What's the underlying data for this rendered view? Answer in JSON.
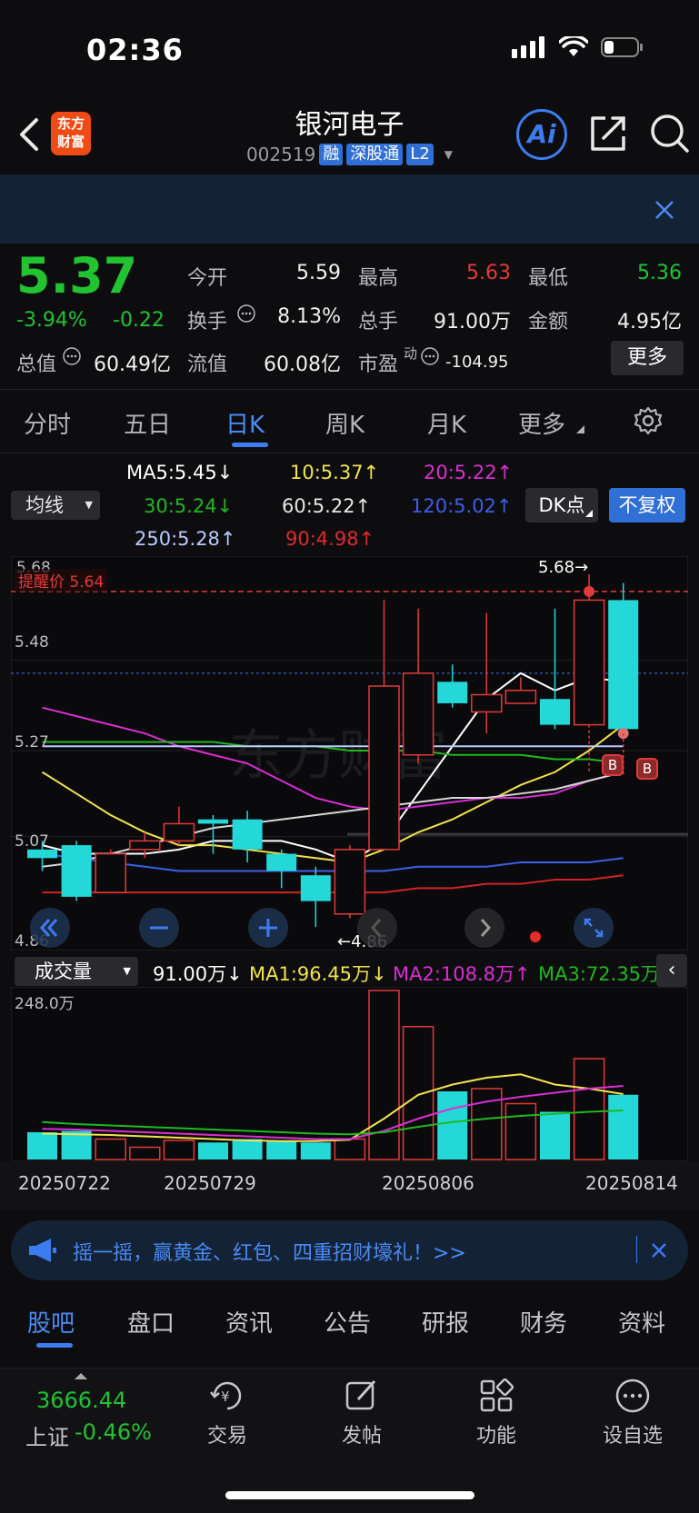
{
  "status": {
    "time": "02:36"
  },
  "header": {
    "logo_line1": "东方",
    "logo_line2": "财富",
    "stock_name": "银河电子",
    "stock_code": "002519",
    "tags": [
      "融",
      "深股通",
      "L2"
    ],
    "ai_label": "Ai"
  },
  "quote": {
    "price": "5.37",
    "change_pct": "-3.94%",
    "change_amt": "-0.22",
    "open_label": "今开",
    "open": "5.59",
    "high_label": "最高",
    "high": "5.63",
    "low_label": "最低",
    "low": "5.36",
    "turnover_label": "换手",
    "turnover": "8.13%",
    "volume_label": "总手",
    "volume": "91.00万",
    "amount_label": "金额",
    "amount": "4.95亿",
    "mktcap_label": "总值",
    "mktcap": "60.49亿",
    "float_label": "流值",
    "float_cap": "60.08亿",
    "pe_label": "市盈",
    "pe_sup": "动",
    "pe": "-104.95",
    "more_label": "更多"
  },
  "chart_tabs": [
    "分时",
    "五日",
    "日K",
    "周K",
    "月K",
    "更多"
  ],
  "ma_panel": {
    "select_label": "均线",
    "ma5": "MA5:5.45↓",
    "ma10": "10:5.37↑",
    "ma20": "20:5.22↑",
    "ma30": "30:5.24↓",
    "ma60": "60:5.22↑",
    "ma120": "120:5.02↑",
    "ma250": "250:5.28↑",
    "ma90": "90:4.98↑",
    "dk_label": "DK点",
    "fq_label": "不复权"
  },
  "kline": {
    "alert_label": "提醒价 5.64",
    "max_label": "5.68→",
    "min_label": "←4.86",
    "y_labels": [
      "5.68",
      "5.48",
      "5.27",
      "5.07",
      "4.86"
    ],
    "watermark": "东方财富",
    "buy_marker": "B"
  },
  "volume": {
    "select_label": "成交量",
    "vol": "91.00万↓",
    "ma1": "MA1:96.45万↓",
    "ma2": "MA2:108.8万↑",
    "ma3": "MA3:72.35万↑",
    "max_label": "248.0万",
    "dates": [
      "20250722",
      "20250729",
      "20250806",
      "20250814"
    ]
  },
  "chart_data": {
    "type": "candlestick",
    "ylim": [
      4.86,
      5.68
    ],
    "candles": [
      {
        "o": 5.04,
        "h": 5.06,
        "l": 4.99,
        "c": 5.02
      },
      {
        "o": 5.05,
        "h": 5.06,
        "l": 4.92,
        "c": 4.93
      },
      {
        "o": 4.94,
        "h": 5.04,
        "l": 4.94,
        "c": 5.03
      },
      {
        "o": 5.04,
        "h": 5.08,
        "l": 5.02,
        "c": 5.06
      },
      {
        "o": 5.06,
        "h": 5.14,
        "l": 5.05,
        "c": 5.1
      },
      {
        "o": 5.11,
        "h": 5.12,
        "l": 5.03,
        "c": 5.1
      },
      {
        "o": 5.11,
        "h": 5.13,
        "l": 5.01,
        "c": 5.04
      },
      {
        "o": 5.03,
        "h": 5.04,
        "l": 4.95,
        "c": 4.99
      },
      {
        "o": 4.98,
        "h": 5.0,
        "l": 4.86,
        "c": 4.92
      },
      {
        "o": 4.89,
        "h": 5.05,
        "l": 4.88,
        "c": 5.04
      },
      {
        "o": 5.04,
        "h": 5.62,
        "l": 5.04,
        "c": 5.42
      },
      {
        "o": 5.26,
        "h": 5.6,
        "l": 5.24,
        "c": 5.45
      },
      {
        "o": 5.43,
        "h": 5.47,
        "l": 5.37,
        "c": 5.38
      },
      {
        "o": 5.36,
        "h": 5.59,
        "l": 5.31,
        "c": 5.4
      },
      {
        "o": 5.38,
        "h": 5.44,
        "l": 5.38,
        "c": 5.41
      },
      {
        "o": 5.39,
        "h": 5.6,
        "l": 5.32,
        "c": 5.33
      },
      {
        "o": 5.33,
        "h": 5.68,
        "l": 5.33,
        "c": 5.62
      },
      {
        "o": 5.62,
        "h": 5.66,
        "l": 5.3,
        "c": 5.32
      }
    ],
    "ma_lines": [
      {
        "name": "MA5",
        "color": "#ffffff",
        "values": [
          5.05,
          5.03,
          5.03,
          5.03,
          5.04,
          5.06,
          5.06,
          5.06,
          5.04,
          5.01,
          5.06,
          5.17,
          5.28,
          5.39,
          5.45,
          5.41,
          5.44,
          5.43
        ]
      },
      {
        "name": "MA10",
        "color": "#f2e34a",
        "values": [
          5.22,
          5.17,
          5.12,
          5.08,
          5.05,
          5.05,
          5.04,
          5.03,
          5.02,
          5.01,
          5.04,
          5.08,
          5.11,
          5.15,
          5.19,
          5.22,
          5.27,
          5.33
        ]
      },
      {
        "name": "MA20",
        "color": "#d82fd2",
        "values": [
          5.37,
          5.35,
          5.33,
          5.31,
          5.28,
          5.26,
          5.24,
          5.2,
          5.16,
          5.14,
          5.13,
          5.14,
          5.15,
          5.16,
          5.16,
          5.17,
          5.2,
          5.22
        ]
      },
      {
        "name": "MA30",
        "color": "#1fb81f",
        "values": [
          5.29,
          5.29,
          5.29,
          5.29,
          5.29,
          5.29,
          5.28,
          5.28,
          5.28,
          5.27,
          5.27,
          5.27,
          5.26,
          5.26,
          5.26,
          5.25,
          5.25,
          5.24
        ]
      },
      {
        "name": "MA60",
        "color": "#d8d8d8",
        "values": [
          5.0,
          5.01,
          5.03,
          5.05,
          5.07,
          5.09,
          5.1,
          5.11,
          5.12,
          5.13,
          5.14,
          5.15,
          5.16,
          5.16,
          5.17,
          5.18,
          5.2,
          5.22
        ]
      },
      {
        "name": "MA120",
        "color": "#3d5de8",
        "values": [
          5.03,
          5.02,
          5.01,
          5.0,
          4.99,
          4.99,
          4.99,
          4.99,
          4.99,
          4.99,
          4.99,
          5.0,
          5.0,
          5.0,
          5.01,
          5.01,
          5.01,
          5.02
        ]
      },
      {
        "name": "MA250",
        "color": "#b9c8ff",
        "values": [
          5.28,
          5.28,
          5.28,
          5.28,
          5.28,
          5.28,
          5.28,
          5.28,
          5.28,
          5.28,
          5.28,
          5.28,
          5.28,
          5.28,
          5.28,
          5.28,
          5.28,
          5.28
        ]
      },
      {
        "name": "MA90",
        "color": "#d02424",
        "values": [
          4.94,
          4.94,
          4.94,
          4.94,
          4.94,
          4.94,
          4.94,
          4.94,
          4.94,
          4.94,
          4.94,
          4.95,
          4.95,
          4.96,
          4.96,
          4.97,
          4.97,
          4.98
        ]
      }
    ],
    "volume_values": [
      40,
      42,
      30,
      18,
      28,
      25,
      30,
      28,
      25,
      30,
      248,
      195,
      100,
      104,
      82,
      70,
      148,
      95
    ],
    "volume_ma": [
      {
        "name": "MA1",
        "color": "#f2e34a",
        "values": [
          38,
          37,
          36,
          34,
          32,
          30,
          28,
          27,
          27,
          29,
          60,
          95,
          110,
          120,
          125,
          110,
          104,
          96
        ]
      },
      {
        "name": "MA2",
        "color": "#d82fd2",
        "values": [
          45,
          44,
          42,
          40,
          38,
          36,
          34,
          32,
          30,
          30,
          42,
          60,
          75,
          85,
          92,
          98,
          104,
          108
        ]
      },
      {
        "name": "MA3",
        "color": "#1fb81f",
        "values": [
          55,
          52,
          50,
          48,
          46,
          44,
          42,
          40,
          38,
          37,
          40,
          48,
          55,
          60,
          64,
          67,
          70,
          72
        ]
      }
    ]
  },
  "promo": {
    "text": "摇一摇，赢黄金、红包、四重招财壕礼！>>"
  },
  "bottom_tabs": [
    "股吧",
    "盘口",
    "资讯",
    "公告",
    "研报",
    "财务",
    "资料"
  ],
  "navbar": {
    "index_value": "3666.44",
    "index_name": "上证",
    "index_change": "-0.46%",
    "items": [
      "交易",
      "发帖",
      "功能",
      "设自选"
    ]
  },
  "colors": {
    "up": "#e23a3a",
    "down": "#24d8d8",
    "fall_text": "#21c331",
    "accent": "#3c7cf0"
  }
}
